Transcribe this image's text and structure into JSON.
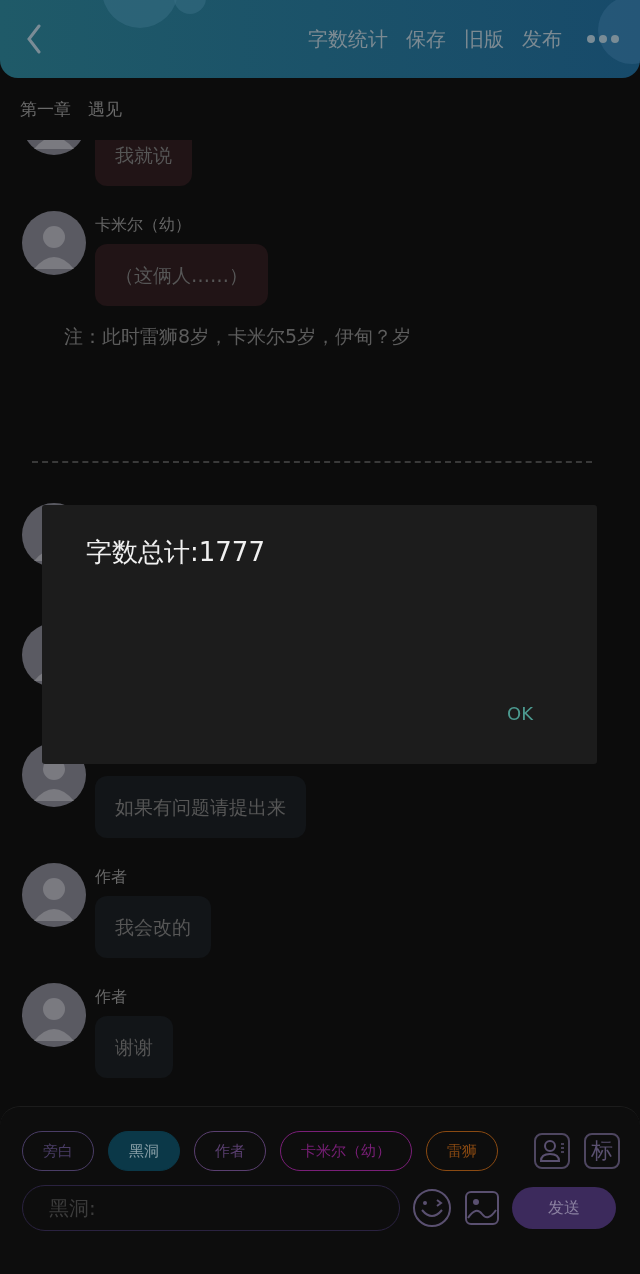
{
  "header": {
    "actions": [
      "字数统计",
      "保存",
      "旧版",
      "发布"
    ]
  },
  "chapter_title": "第一章　遇见",
  "messages": [
    {
      "kind": "message",
      "color": "#211416",
      "text": "我就说"
    },
    {
      "kind": "message",
      "color": "#211416",
      "author": "卡米尔（幼）",
      "text": "（这俩人……）"
    },
    {
      "kind": "note",
      "text": "注：此时雷狮8岁，卡米尔5岁，伊甸？岁"
    },
    {
      "kind": "divider"
    },
    {
      "kind": "covered"
    },
    {
      "kind": "covered"
    },
    {
      "kind": "message",
      "color": "#121518",
      "text": "如果有问题请提出来"
    },
    {
      "kind": "message",
      "color": "#121518",
      "author": "作者",
      "text": "我会改的"
    },
    {
      "kind": "message",
      "color": "#121518",
      "author": "作者",
      "text": "谢谢"
    }
  ],
  "dialog": {
    "message": "字数总计:1777",
    "button": "OK"
  },
  "roles": [
    {
      "label": "旁白",
      "color": "#4a3d66",
      "selected": false
    },
    {
      "label": "黑洞",
      "color": "#0b3848",
      "selected": true
    },
    {
      "label": "作者",
      "color": "#5a3f70",
      "selected": false
    },
    {
      "label": "卡米尔（幼）",
      "color": "#7a1f78",
      "selected": false
    },
    {
      "label": "雷狮",
      "color": "#8a4a12",
      "selected": false
    }
  ],
  "tag_button": "标",
  "input": {
    "placeholder": "黑洞:"
  },
  "send_button": "发送"
}
